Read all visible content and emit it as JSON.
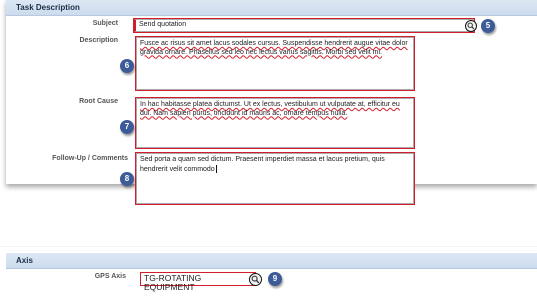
{
  "task_panel": {
    "title": "Task Description",
    "subject": {
      "label": "Subject",
      "value": "Send quotation",
      "badge": "5"
    },
    "description": {
      "label": "Description",
      "value": "Fusce ac risus sit amet lacus sodales cursus. Suspendisse hendrerit augue vitae dolor gravida ornare. Phasellus sed leo nec lectus varius sagittis. Morbi sed velit mi.",
      "badge": "6"
    },
    "root_cause": {
      "label": "Root Cause",
      "value": "In hac habitasse platea dictumst. Ut ex lectus, vestibulum ut vulputate at, efficitur eu dui. Nam sapien purus, tincidunt id mauris ac, ornare tempus nulla.",
      "badge": "7"
    },
    "follow_up": {
      "label": "Follow-Up / Comments",
      "value": "Sed porta a quam sed dictum. Praesent imperdiet massa et lacus pretium, quis hendrerit velit commodo",
      "badge": "8"
    }
  },
  "axis_panel": {
    "title": "Axis",
    "gps_axis": {
      "label": "GPS Axis",
      "value": "TG-ROTATING EQUIPMENT",
      "badge": "9"
    }
  },
  "colors": {
    "highlight": "#d21e2b",
    "badge": "#3d5a99",
    "header": "#dce7f3"
  },
  "icons": {
    "lookup": "magnifier-icon"
  }
}
